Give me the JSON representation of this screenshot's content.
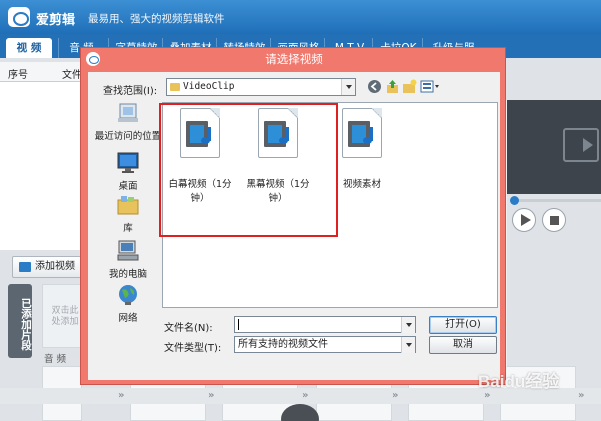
{
  "app": {
    "name": "爱剪辑",
    "slogan": "最易用、强大的视频剪辑软件"
  },
  "menu": {
    "items": [
      "视 频",
      "音 频",
      "字幕特效",
      "叠加素材",
      "转场特效",
      "画面风格",
      "M T V",
      "卡拉OK",
      "升级与服务"
    ]
  },
  "list": {
    "col_index": "序号",
    "col_file": "文件"
  },
  "left_panel": {
    "add_video": "添加视频",
    "added_clips_tab": "已添加片段",
    "clip_hint": "双击此处添加",
    "audio_label": "音 频"
  },
  "dialog": {
    "title": "请选择视频",
    "look_in_label": "查找范围(I):",
    "look_in_value": "VideoClip",
    "places": [
      "最近访问的位置",
      "桌面",
      "库",
      "我的电脑",
      "网络"
    ],
    "files": [
      "白幕视频（1分钟）",
      "黑幕视频（1分钟）",
      "视频素材"
    ],
    "filename_label": "文件名(N):",
    "filename_value": "",
    "filetype_label": "文件类型(T):",
    "filetype_value": "所有支持的视频文件",
    "open_button": "打开(O)",
    "cancel_button": "取消"
  },
  "watermark": "Baidu经验",
  "colors": {
    "titlebar": "#1e6fb8",
    "dialog_frame": "#f0786d",
    "highlight_box": "#e02020"
  }
}
